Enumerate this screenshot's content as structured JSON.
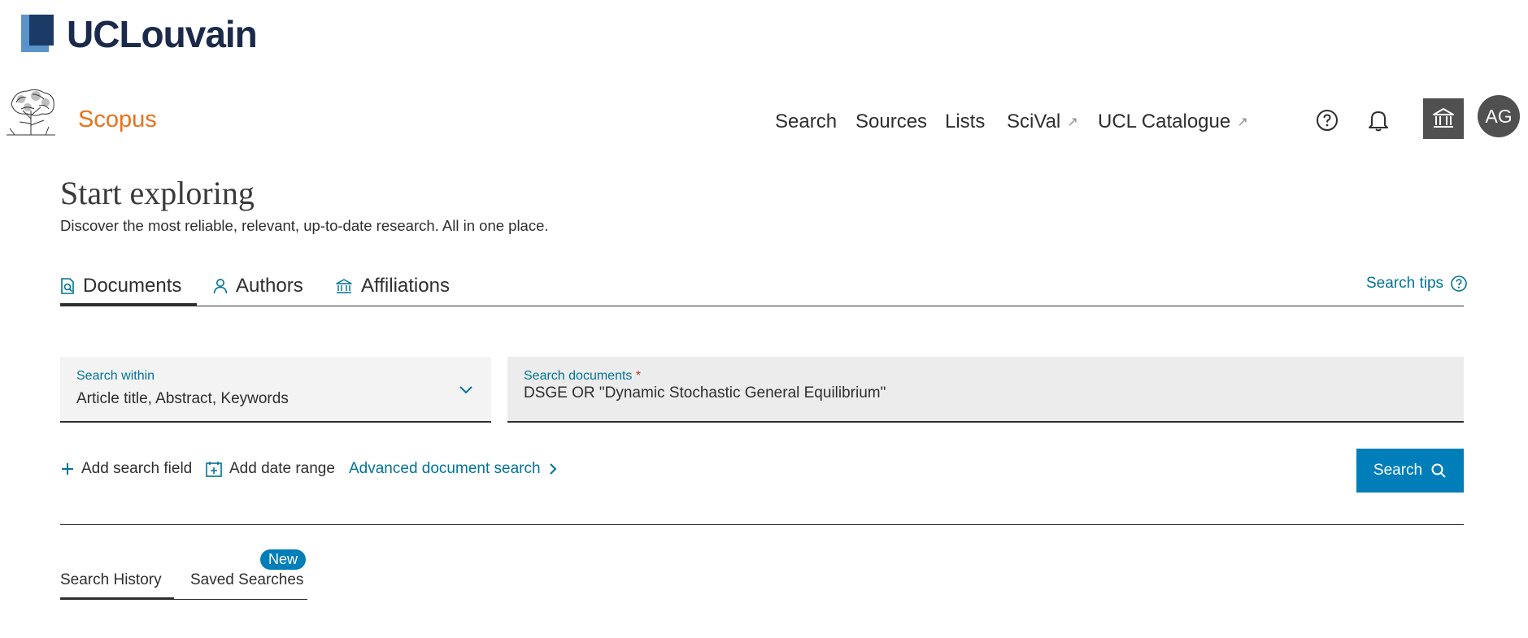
{
  "institution": {
    "name": "UCLouvain"
  },
  "header": {
    "brand": "Scopus",
    "nav": [
      {
        "label": "Search",
        "external": false
      },
      {
        "label": "Sources",
        "external": false
      },
      {
        "label": "Lists",
        "external": false
      },
      {
        "label": "SciVal",
        "external": true,
        "ext_glyph": "↗"
      },
      {
        "label": "UCL Catalogue",
        "external": true,
        "ext_glyph": "↗"
      }
    ],
    "icons": [
      "help-icon",
      "bell-icon",
      "institution-icon"
    ],
    "avatar_initials": "AG"
  },
  "hero": {
    "title": "Start exploring",
    "subtitle": "Discover the most reliable, relevant, up-to-date research. All in one place."
  },
  "tabs": {
    "items": [
      {
        "label": "Documents",
        "icon": "document-search-icon",
        "active": true
      },
      {
        "label": "Authors",
        "icon": "person-icon",
        "active": false
      },
      {
        "label": "Affiliations",
        "icon": "building-icon",
        "active": false
      }
    ],
    "search_tips": "Search tips"
  },
  "search": {
    "within_label": "Search within",
    "within_value": "Article title, Abstract, Keywords",
    "docs_label": "Search documents",
    "required_marker": "*",
    "query": "DSGE OR \"Dynamic Stochastic General Equilibrium\""
  },
  "actions": {
    "add_field": "Add search field",
    "add_date": "Add date range",
    "advanced": "Advanced document search",
    "search_button": "Search"
  },
  "history": {
    "tabs": [
      "Search History",
      "Saved Searches"
    ],
    "badge": "New"
  },
  "colors": {
    "accent": "#007eb9",
    "link": "#007398",
    "brand": "#e9711c",
    "dark": "#2e2e2e"
  }
}
